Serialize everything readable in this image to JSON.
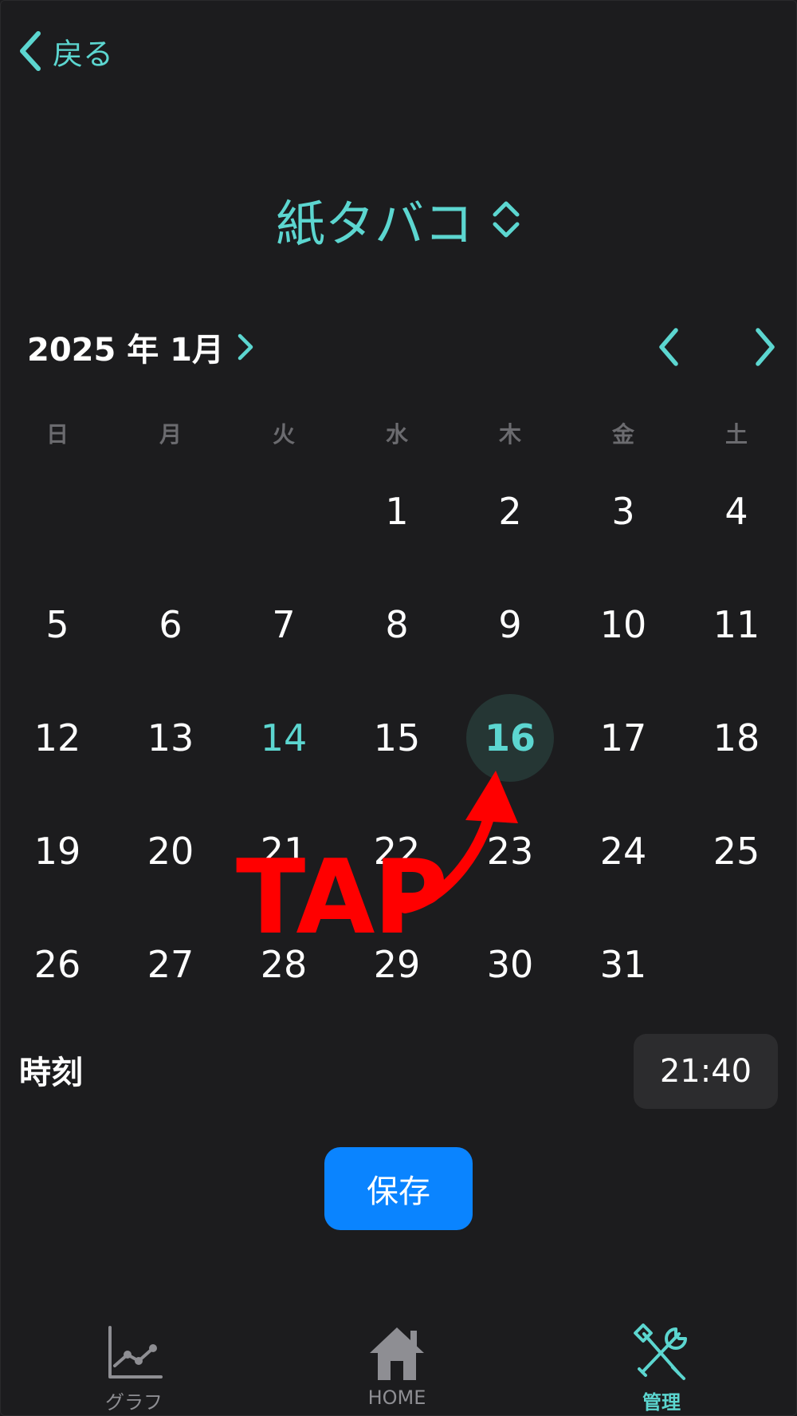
{
  "header": {
    "back_label": "戻る"
  },
  "title": "紙タバコ",
  "calendar": {
    "month_label": "2025 年 1月",
    "weekdays": [
      "日",
      "月",
      "火",
      "水",
      "木",
      "金",
      "土"
    ],
    "days": [
      "1",
      "2",
      "3",
      "4",
      "5",
      "6",
      "7",
      "8",
      "9",
      "10",
      "11",
      "12",
      "13",
      "14",
      "15",
      "16",
      "17",
      "18",
      "19",
      "20",
      "21",
      "22",
      "23",
      "24",
      "25",
      "26",
      "27",
      "28",
      "29",
      "30",
      "31"
    ],
    "first_weekday_index": 3,
    "today": "14",
    "selected": "16"
  },
  "time": {
    "label": "時刻",
    "value": "21:40"
  },
  "save_label": "保存",
  "tabs": [
    {
      "label": "グラフ",
      "icon": "chart-icon"
    },
    {
      "label": "HOME",
      "icon": "home-icon"
    },
    {
      "label": "管理",
      "icon": "tools-icon"
    }
  ],
  "active_tab": 2,
  "annotation": {
    "text": "TAP"
  },
  "colors": {
    "accent": "#5cd6d0",
    "primary_button": "#0a84ff",
    "background": "#1c1c1e",
    "annotation": "#ff0000"
  }
}
